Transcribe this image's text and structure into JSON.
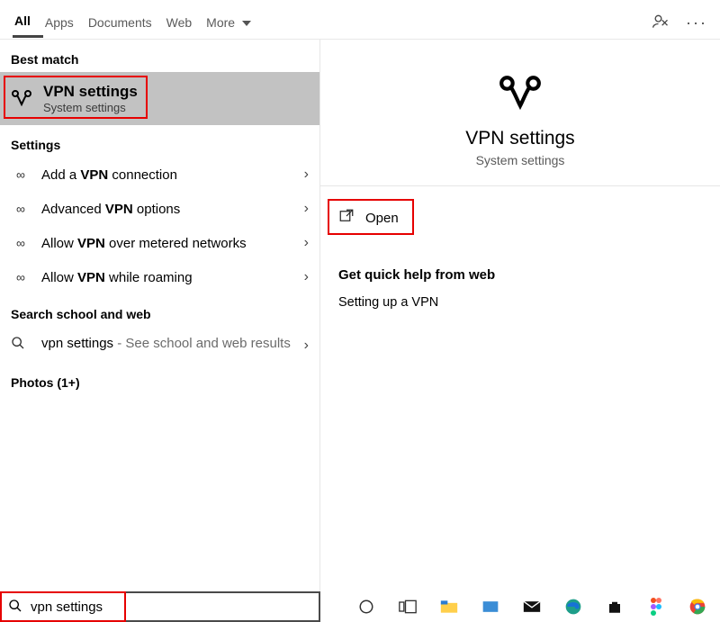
{
  "tabs": {
    "all": "All",
    "apps": "Apps",
    "documents": "Documents",
    "web": "Web",
    "more": "More"
  },
  "sections": {
    "bestMatch": "Best match",
    "settings": "Settings",
    "searchWeb": "Search school and web",
    "photos": "Photos (1+)"
  },
  "bestMatch": {
    "title": "VPN settings",
    "sub": "System settings"
  },
  "settingsList": {
    "addVpnPre": "Add a ",
    "addVpnStrong": "VPN",
    "addVpnPost": " connection",
    "advancedPre": "Advanced ",
    "advancedStrong": "VPN",
    "advancedPost": " options",
    "meteredPre": "Allow ",
    "meteredStrong": "VPN",
    "meteredPost": " over metered networks",
    "roamingPre": "Allow ",
    "roamingStrong": "VPN",
    "roamingPost": " while roaming"
  },
  "searchWeb": {
    "query": "vpn settings",
    "hint": " - See school and web results"
  },
  "rightPane": {
    "title": "VPN settings",
    "sub": "System settings",
    "open": "Open",
    "helpHeader": "Get quick help from web",
    "helpItem1": "Setting up a VPN"
  },
  "searchBox": {
    "value": "vpn settings"
  }
}
